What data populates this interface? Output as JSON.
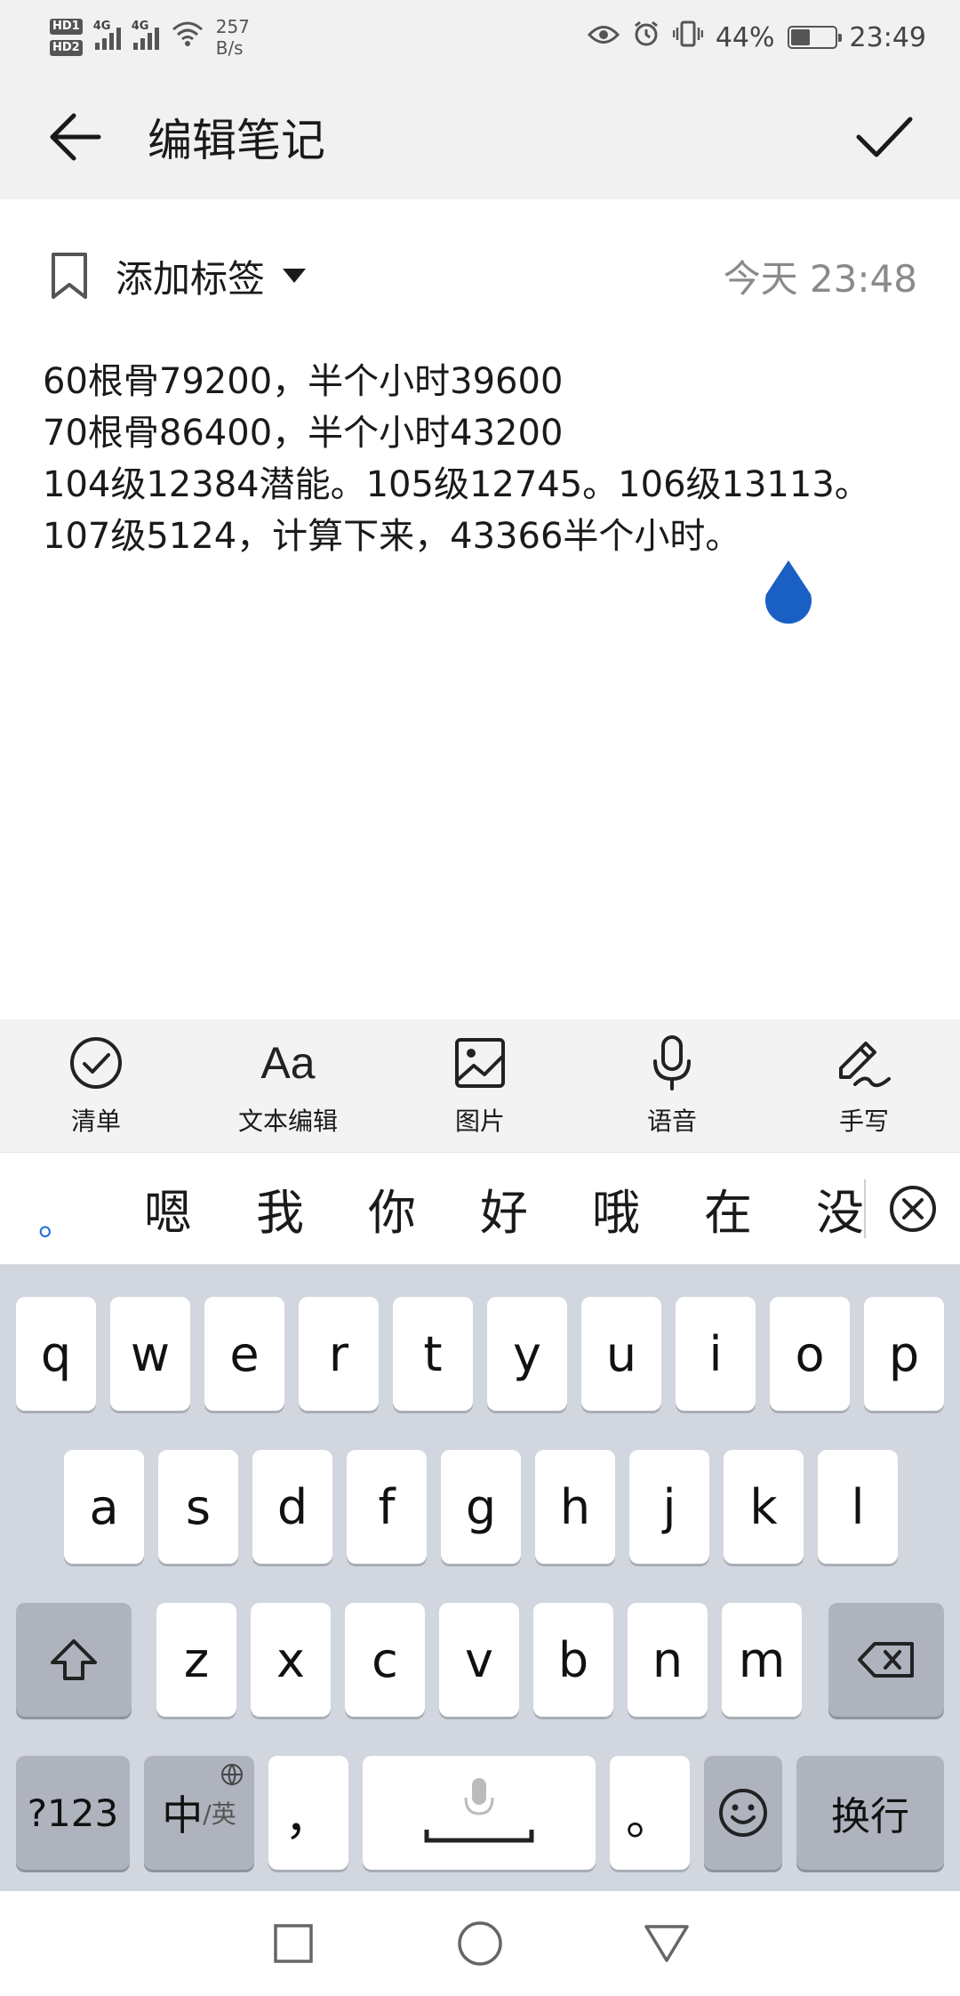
{
  "status_bar": {
    "hd1": "HD1",
    "hd2": "HD2",
    "net1": "4G",
    "net2": "4G",
    "speed_value": "257",
    "speed_unit": "B/s",
    "battery": "44%",
    "battery_level": 0.44,
    "time": "23:49"
  },
  "header": {
    "title": "编辑笔记"
  },
  "meta": {
    "tag_label": "添加标签",
    "time": "今天 23:48"
  },
  "note": {
    "lines": [
      "60根骨79200，半个小时39600",
      "70根骨86400，半个小时43200",
      "104级12384潜能。105级12745。106级13113。",
      "107级5124，计算下来，43366半个小时。"
    ]
  },
  "toolbar": {
    "items": [
      {
        "label": "清单",
        "icon": "checklist-icon"
      },
      {
        "label": "文本编辑",
        "icon": "text-edit-icon",
        "glyph": "Aa"
      },
      {
        "label": "图片",
        "icon": "image-icon"
      },
      {
        "label": "语音",
        "icon": "microphone-icon"
      },
      {
        "label": "手写",
        "icon": "handwriting-icon"
      }
    ]
  },
  "candidates": {
    "punct": "。",
    "items": [
      "嗯",
      "我",
      "你",
      "好",
      "哦",
      "在",
      "没"
    ]
  },
  "keyboard": {
    "row1": [
      "q",
      "w",
      "e",
      "r",
      "t",
      "y",
      "u",
      "i",
      "o",
      "p"
    ],
    "row2": [
      "a",
      "s",
      "d",
      "f",
      "g",
      "h",
      "j",
      "k",
      "l"
    ],
    "row3": [
      "z",
      "x",
      "c",
      "v",
      "b",
      "n",
      "m"
    ],
    "num_key": "?123",
    "lang_main": "中",
    "lang_sub": "/英",
    "comma": "，",
    "period": "。",
    "enter": "换行"
  },
  "colors": {
    "accent": "#1f6fd1",
    "handle": "#1a5fc4",
    "keyboard_bg": "#d2d6de"
  }
}
